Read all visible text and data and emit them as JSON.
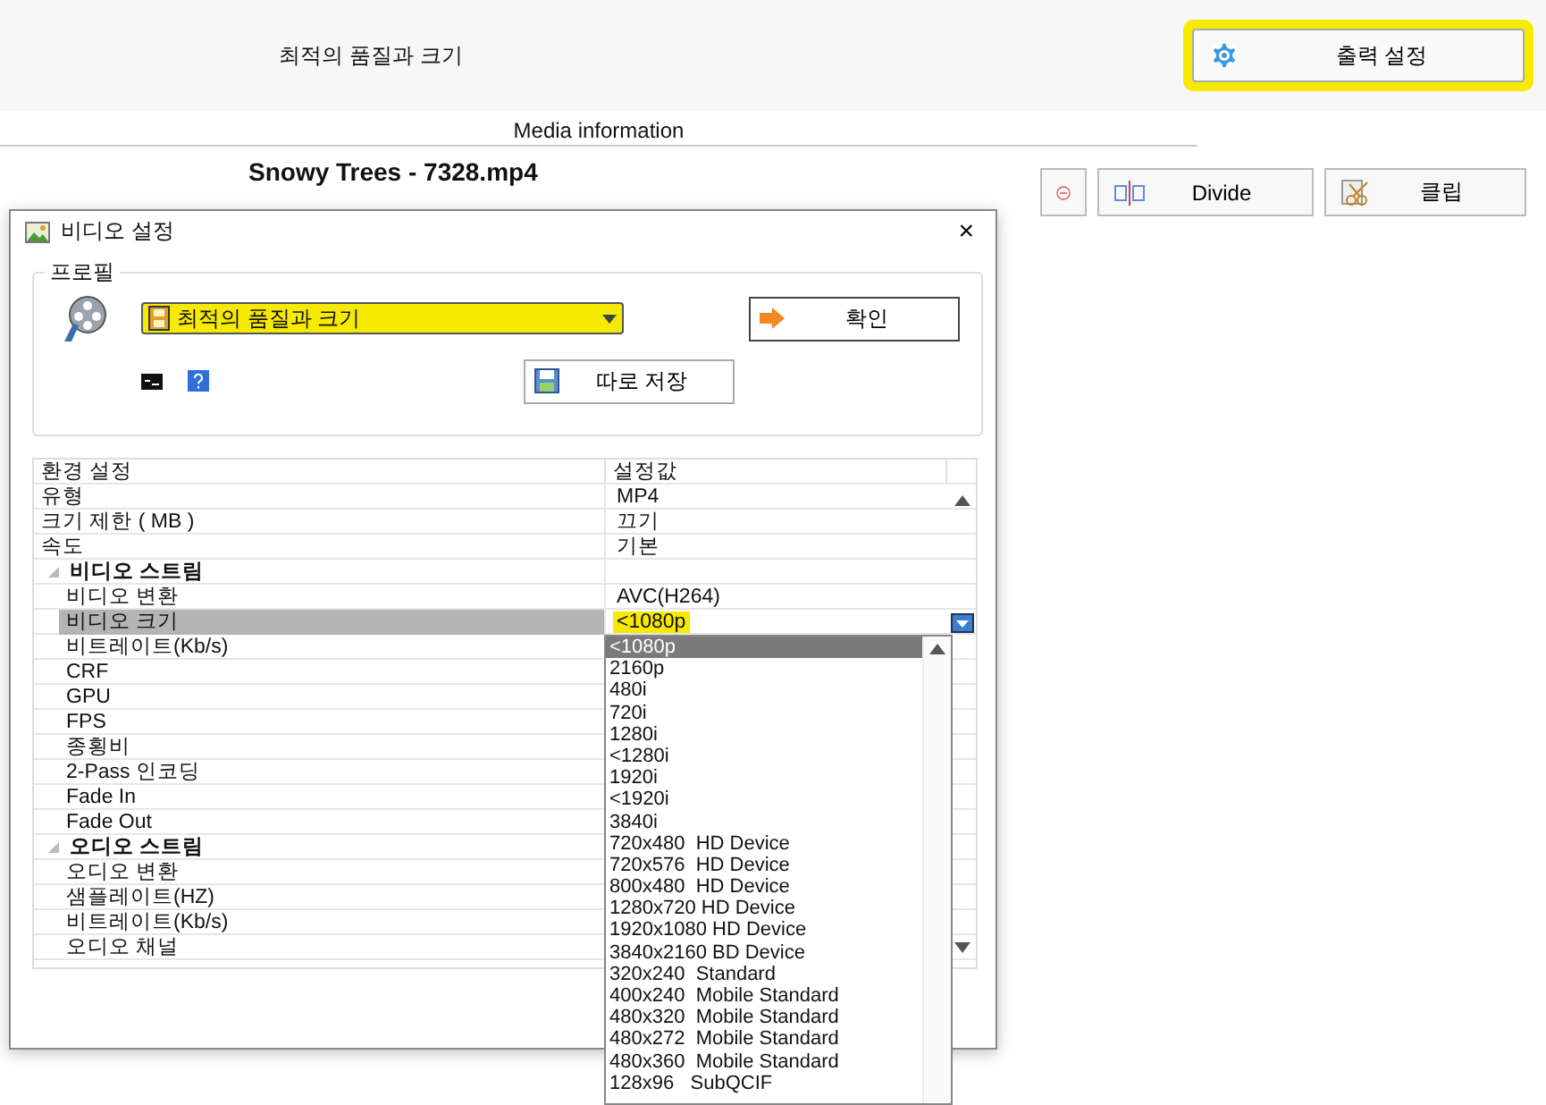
{
  "header": {
    "title": "최적의 품질과 크기",
    "output_button": {
      "label": "출력 설정",
      "highlighted": true
    }
  },
  "media": {
    "section_label": "Media information",
    "file_name": "Snowy Trees - 7328.mp4",
    "buttons": [
      {
        "kind": "remove"
      },
      {
        "kind": "divide",
        "label": "Divide"
      },
      {
        "kind": "clip",
        "label": "클립"
      }
    ]
  },
  "dialog": {
    "title": "비디오 설정",
    "close": "×",
    "profile_group": "프로필",
    "profile_select": {
      "value": "최적의 품질과 크기",
      "highlighted": true
    },
    "confirm_button": "확인",
    "save_button": "따로 저장",
    "grid": {
      "columns": [
        "환경 설정",
        "설정값"
      ],
      "rows": [
        {
          "kind": "row",
          "name": "유형",
          "value": "MP4",
          "selected": false
        },
        {
          "kind": "row",
          "name": "크기 제한 ( MB )",
          "value": "끄기",
          "selected": false
        },
        {
          "kind": "row",
          "name": "속도",
          "value": "기본",
          "selected": false
        },
        {
          "kind": "category",
          "name": "비디오 스트림",
          "expanded": true
        },
        {
          "kind": "row",
          "name": "비디오 변환",
          "value": "AVC(H264)",
          "selected": false
        },
        {
          "kind": "row",
          "name": "비디오 크기",
          "value": "<1080p",
          "selected": true,
          "highlighted": true
        },
        {
          "kind": "row",
          "name": "비트레이트(Kb/s)",
          "selected": false
        },
        {
          "kind": "row",
          "name": "CRF",
          "selected": false
        },
        {
          "kind": "row",
          "name": "GPU",
          "selected": false
        },
        {
          "kind": "row",
          "name": "FPS",
          "selected": false
        },
        {
          "kind": "row",
          "name": "종횡비",
          "selected": false
        },
        {
          "kind": "row",
          "name": "2-Pass 인코딩",
          "selected": false
        },
        {
          "kind": "row",
          "name": "Fade In",
          "selected": false
        },
        {
          "kind": "row",
          "name": "Fade Out",
          "selected": false
        },
        {
          "kind": "category",
          "name": "오디오 스트림",
          "expanded": true
        },
        {
          "kind": "row",
          "name": "오디오 변환",
          "selected": false
        },
        {
          "kind": "row",
          "name": "샘플레이트(HZ)",
          "selected": false
        },
        {
          "kind": "row",
          "name": "비트레이트(Kb/s)",
          "selected": false
        },
        {
          "kind": "row",
          "name": "오디오 채널",
          "selected": false
        }
      ]
    },
    "dropdown": [
      {
        "label": "<1080p",
        "selected": true
      },
      {
        "label": "2160p",
        "selected": false
      },
      {
        "label": "480i",
        "selected": false
      },
      {
        "label": "720i",
        "selected": false
      },
      {
        "label": "1280i",
        "selected": false
      },
      {
        "label": "<1280i",
        "selected": false
      },
      {
        "label": "1920i",
        "selected": false
      },
      {
        "label": "<1920i",
        "selected": false
      },
      {
        "label": "3840i",
        "selected": false
      },
      {
        "label": "720x480  HD Device",
        "selected": false
      },
      {
        "label": "720x576  HD Device",
        "selected": false
      },
      {
        "label": "800x480  HD Device",
        "selected": false
      },
      {
        "label": "1280x720 HD Device",
        "selected": false
      },
      {
        "label": "1920x1080 HD Device",
        "selected": false
      },
      {
        "label": "3840x2160 BD Device",
        "selected": false
      },
      {
        "label": "320x240  Standard",
        "selected": false
      },
      {
        "label": "400x240  Mobile Standard",
        "selected": false
      },
      {
        "label": "480x320  Mobile Standard",
        "selected": false
      },
      {
        "label": "480x272  Mobile Standard",
        "selected": false
      },
      {
        "label": "480x360  Mobile Standard",
        "selected": false
      },
      {
        "label": "128x96   SubQCIF",
        "selected": false
      }
    ]
  }
}
